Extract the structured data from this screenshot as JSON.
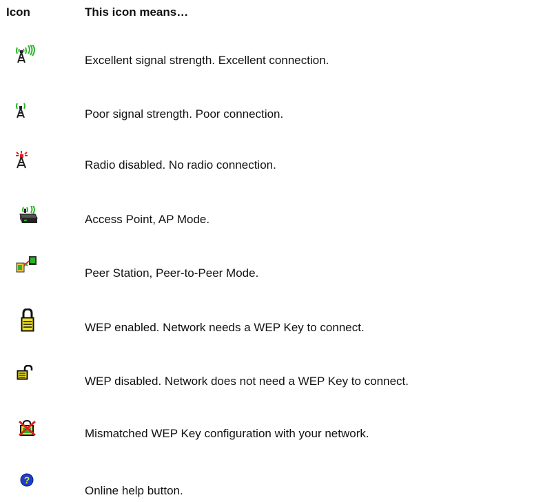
{
  "header": {
    "icon_col": "Icon",
    "desc_col": "This icon means…"
  },
  "rows": [
    {
      "icon": "signal-excellent-icon",
      "text": "Excellent signal strength. Excellent connection."
    },
    {
      "icon": "signal-poor-icon",
      "text": "Poor signal strength. Poor connection."
    },
    {
      "icon": "radio-disabled-icon",
      "text": "Radio disabled. No radio connection."
    },
    {
      "icon": "access-point-icon",
      "text": "Access Point, AP Mode."
    },
    {
      "icon": "peer-station-icon",
      "text": "Peer Station, Peer-to-Peer Mode."
    },
    {
      "icon": "lock-closed-icon",
      "text": "WEP enabled. Network needs a WEP Key to connect."
    },
    {
      "icon": "lock-open-icon",
      "text": "WEP disabled. Network does not need a WEP Key to connect."
    },
    {
      "icon": "wep-mismatch-icon",
      "text": "Mismatched WEP Key configuration with your network."
    },
    {
      "icon": "help-icon",
      "text": "Online help button."
    }
  ],
  "colors": {
    "green": "#2bb52b",
    "red": "#e02020",
    "yellow": "#f0e020",
    "blue": "#1a3fd0"
  }
}
